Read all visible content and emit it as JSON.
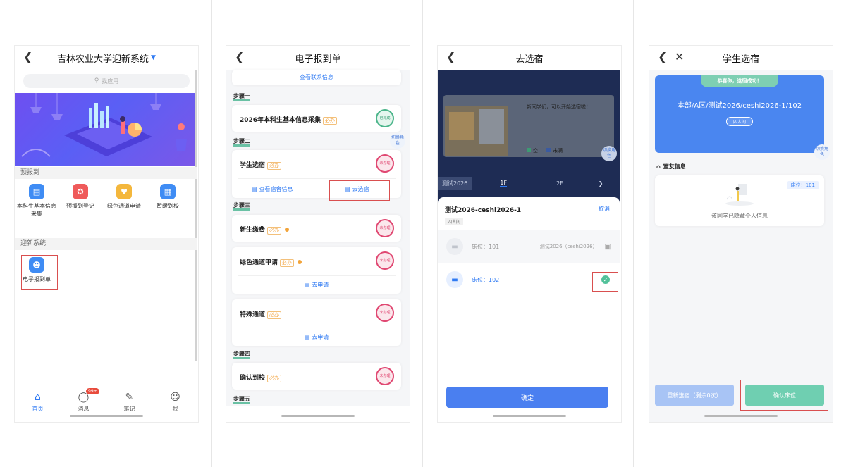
{
  "screen1": {
    "title": "吉林农业大学迎新系统",
    "search_placeholder": "找应用",
    "section_pre": "预报到",
    "apps": [
      {
        "label": "本科生基本信息采集",
        "icon": "document-icon",
        "color": "#3f8cf4"
      },
      {
        "label": "预报到登记",
        "icon": "walk-icon",
        "color": "#ef5a5a"
      },
      {
        "label": "绿色通道申请",
        "icon": "handshake-icon",
        "color": "#f4b73c"
      },
      {
        "label": "暂缓到校",
        "icon": "building-icon",
        "color": "#3f8cf4"
      }
    ],
    "section_system": "迎新系统",
    "system_app": {
      "label": "电子报到单",
      "icon": "user-card-icon",
      "color": "#3f8cf4"
    },
    "tabs": [
      {
        "label": "首页",
        "icon": "home-icon"
      },
      {
        "label": "消息",
        "icon": "chat-icon",
        "badge": "99+"
      },
      {
        "label": "笔记",
        "icon": "note-icon"
      },
      {
        "label": "我",
        "icon": "person-icon"
      }
    ]
  },
  "screen2": {
    "title": "电子报到单",
    "contact_link": "查看联系信息",
    "step1": "步骤一",
    "card1": {
      "title": "2026年本科生基本信息采集",
      "tag": "必办",
      "stamp": "已完成"
    },
    "switch_role": "切换角色",
    "step2": "步骤二",
    "card2": {
      "title": "学生选宿",
      "tag": "必办",
      "stamp": "未办理",
      "btn_left": "查看宿舍信息",
      "btn_right": "去选宿"
    },
    "step3": "步骤三",
    "card3": {
      "title": "新生缴费",
      "tag": "必办",
      "stamp": "未办理"
    },
    "card4": {
      "title": "绿色通道申请",
      "tag": "必办",
      "stamp": "未办理",
      "btn": "去申请"
    },
    "card5": {
      "title": "特殊通道",
      "tag": "必办",
      "stamp": "未办理",
      "btn": "去申请"
    },
    "step4": "步骤四",
    "card6": {
      "title": "确认到校",
      "tag": "必办",
      "stamp": "未办理"
    },
    "step5": "步骤五"
  },
  "screen3": {
    "title": "去选宿",
    "bg_notice": "新同学们，可以开始选宿啦！",
    "legend_empty": "空",
    "legend_full": "未满",
    "switch_role": "切换角色",
    "building_tab": "测试2026",
    "floor_1": "1F",
    "floor_2": "2F",
    "room_name": "测试2026-ceshi2026-1",
    "cancel": "取消",
    "room_type": "四人间",
    "beds": [
      {
        "label": "床位：101",
        "occupant": "测试2026（ceshi2026）",
        "status": "locked"
      },
      {
        "label": "床位：102",
        "occupant": "",
        "status": "selected"
      }
    ],
    "confirm": "确定"
  },
  "screen4": {
    "title": "学生选宿",
    "success": "恭喜你，选宿成功！",
    "location": "本部/A区/测试2026/ceshi2026-1/102",
    "room_type": "四人间",
    "switch_role": "切换角色",
    "roommates_header": "室友信息",
    "roommate_bed": "床位：101",
    "hidden_info": "该同学已隐藏个人信息",
    "reselect": "重新选宿（剩余0次）",
    "confirm_bed": "确认床位"
  }
}
